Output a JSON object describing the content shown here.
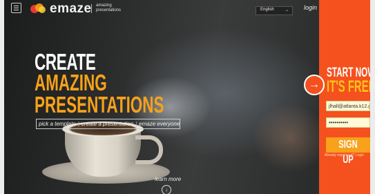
{
  "header": {
    "logo_text": "emaze",
    "tagline": "amazing presentations",
    "language": "English",
    "login_label": "login"
  },
  "hero": {
    "line1": "CREATE",
    "line2": "AMAZING",
    "line3": "PRESENTATIONS",
    "steps": [
      "pick a template",
      "create a presentation",
      "emaze everyone"
    ],
    "learn_more": "learn more"
  },
  "signup_panel": {
    "start_now": "START NOW!",
    "its_free": "IT'S FREE",
    "email_value": "jlhall@atlanta.k12.g",
    "password_value": "••••••••••",
    "signup_label": "SIGN UP",
    "already_registered": "Already registered?",
    "login_link": "Login"
  },
  "colors": {
    "panel": "#f4511e",
    "accent_orange": "#f7a21a",
    "free_yellow": "#ffc21a"
  }
}
